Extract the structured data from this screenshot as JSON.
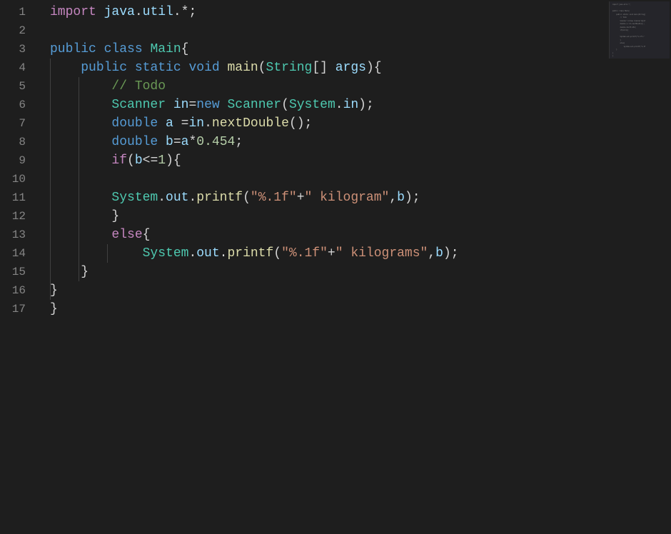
{
  "lineCount": 17,
  "code": {
    "l1": [
      [
        "tok-key",
        "import"
      ],
      [
        "tok-plain",
        " "
      ],
      [
        "tok-var",
        "java"
      ],
      [
        "tok-punc",
        "."
      ],
      [
        "tok-var",
        "util"
      ],
      [
        "tok-punc",
        ".*;"
      ]
    ],
    "l2": [],
    "l3": [
      [
        "tok-mod",
        "public"
      ],
      [
        "tok-plain",
        " "
      ],
      [
        "tok-mod",
        "class"
      ],
      [
        "tok-plain",
        " "
      ],
      [
        "tok-type",
        "Main"
      ],
      [
        "tok-punc",
        "{"
      ]
    ],
    "l4": [
      [
        "tok-plain",
        "    "
      ],
      [
        "tok-mod",
        "public"
      ],
      [
        "tok-plain",
        " "
      ],
      [
        "tok-mod",
        "static"
      ],
      [
        "tok-plain",
        " "
      ],
      [
        "tok-mod",
        "void"
      ],
      [
        "tok-plain",
        " "
      ],
      [
        "tok-func",
        "main"
      ],
      [
        "tok-punc",
        "("
      ],
      [
        "tok-type",
        "String"
      ],
      [
        "tok-punc",
        "[] "
      ],
      [
        "tok-var",
        "args"
      ],
      [
        "tok-punc",
        "){"
      ]
    ],
    "l5": [
      [
        "tok-plain",
        "        "
      ],
      [
        "tok-comment",
        "// Todo"
      ]
    ],
    "l6": [
      [
        "tok-plain",
        "        "
      ],
      [
        "tok-type",
        "Scanner"
      ],
      [
        "tok-plain",
        " "
      ],
      [
        "tok-var",
        "in"
      ],
      [
        "tok-punc",
        "="
      ],
      [
        "tok-mod",
        "new"
      ],
      [
        "tok-plain",
        " "
      ],
      [
        "tok-type",
        "Scanner"
      ],
      [
        "tok-punc",
        "("
      ],
      [
        "tok-type",
        "System"
      ],
      [
        "tok-punc",
        "."
      ],
      [
        "tok-var",
        "in"
      ],
      [
        "tok-punc",
        ");"
      ]
    ],
    "l7": [
      [
        "tok-plain",
        "        "
      ],
      [
        "tok-mod",
        "double"
      ],
      [
        "tok-plain",
        " "
      ],
      [
        "tok-var",
        "a"
      ],
      [
        "tok-plain",
        " "
      ],
      [
        "tok-punc",
        "="
      ],
      [
        "tok-var",
        "in"
      ],
      [
        "tok-punc",
        "."
      ],
      [
        "tok-func",
        "nextDouble"
      ],
      [
        "tok-punc",
        "();"
      ]
    ],
    "l8": [
      [
        "tok-plain",
        "        "
      ],
      [
        "tok-mod",
        "double"
      ],
      [
        "tok-plain",
        " "
      ],
      [
        "tok-var",
        "b"
      ],
      [
        "tok-punc",
        "="
      ],
      [
        "tok-var",
        "a"
      ],
      [
        "tok-punc",
        "*"
      ],
      [
        "tok-num",
        "0.454"
      ],
      [
        "tok-punc",
        ";"
      ]
    ],
    "l9": [
      [
        "tok-plain",
        "        "
      ],
      [
        "tok-key",
        "if"
      ],
      [
        "tok-punc",
        "("
      ],
      [
        "tok-var",
        "b"
      ],
      [
        "tok-punc",
        "<="
      ],
      [
        "tok-num",
        "1"
      ],
      [
        "tok-punc",
        "){"
      ]
    ],
    "l10": [],
    "l11": [
      [
        "tok-plain",
        "        "
      ],
      [
        "tok-type",
        "System"
      ],
      [
        "tok-punc",
        "."
      ],
      [
        "tok-var",
        "out"
      ],
      [
        "tok-punc",
        "."
      ],
      [
        "tok-func",
        "printf"
      ],
      [
        "tok-punc",
        "("
      ],
      [
        "tok-str",
        "\"%.1f\""
      ],
      [
        "tok-punc",
        "+"
      ],
      [
        "tok-str",
        "\" kilogram\""
      ],
      [
        "tok-punc",
        ","
      ],
      [
        "tok-var",
        "b"
      ],
      [
        "tok-punc",
        ");"
      ]
    ],
    "l12": [
      [
        "tok-plain",
        "        }"
      ]
    ],
    "l13": [
      [
        "tok-plain",
        "        "
      ],
      [
        "tok-key",
        "else"
      ],
      [
        "tok-punc",
        "{"
      ]
    ],
    "l14": [
      [
        "tok-plain",
        "            "
      ],
      [
        "tok-type",
        "System"
      ],
      [
        "tok-punc",
        "."
      ],
      [
        "tok-var",
        "out"
      ],
      [
        "tok-punc",
        "."
      ],
      [
        "tok-func",
        "printf"
      ],
      [
        "tok-punc",
        "("
      ],
      [
        "tok-str",
        "\"%.1f\""
      ],
      [
        "tok-punc",
        "+"
      ],
      [
        "tok-str",
        "\" kilograms\""
      ],
      [
        "tok-punc",
        ","
      ],
      [
        "tok-var",
        "b"
      ],
      [
        "tok-punc",
        ");"
      ]
    ],
    "l15": [
      [
        "tok-plain",
        "    }"
      ]
    ],
    "l16": [
      [
        "tok-plain",
        "}"
      ]
    ],
    "l17": [
      [
        "tok-plain",
        "}"
      ]
    ]
  },
  "minimap": [
    "import java.util.*;",
    "",
    "public class Main{",
    "    public static void main(String[",
    "        // Todo",
    "        Scanner in=new Scanner(Syst",
    "        double a =in.nextDouble();",
    "        double b=a*0.454;",
    "        if(b<=1){",
    "",
    "        System.out.printf(\"%.1f\"+\"",
    "        }",
    "        else{",
    "            System.out.printf(\"%.1f",
    "    }",
    "}",
    "}"
  ]
}
